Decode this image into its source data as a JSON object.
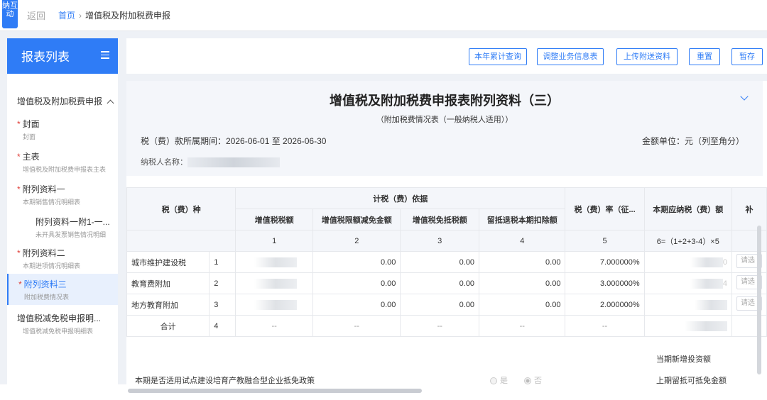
{
  "side_tag": "纳互动",
  "header": {
    "back": "返回",
    "home": "首页",
    "sep": "›",
    "current": "增值税及附加税费申报"
  },
  "sidebar": {
    "title": "报表列表",
    "group": "增值税及附加税费申报",
    "items": [
      {
        "star": "*",
        "title": "封面",
        "sub": "封面"
      },
      {
        "star": "*",
        "title": "主表",
        "sub": "增值税及附加税费申报表主表"
      },
      {
        "star": "*",
        "title": "附列资料一",
        "sub": "本期销售情况明细表"
      },
      {
        "star": "",
        "title": "附列资料一附1-一...",
        "sub": "未开具发票销售情况明细"
      },
      {
        "star": "*",
        "title": "附列资料二",
        "sub": "本期进项情况明细表"
      },
      {
        "star": "*",
        "title": "附列资料三",
        "sub": "附加税费情况表"
      },
      {
        "star": "",
        "title": "增值税减免税申报明...",
        "sub": "增值税减免税申报明细表"
      }
    ]
  },
  "toolbar": {
    "annual_query": "本年累计查询",
    "adjust_info": "调整业务信息表",
    "upload_attachment": "上传附送资料",
    "reset": "重置",
    "save_draft": "暂存"
  },
  "form": {
    "title": "增值税及附加税费申报表附列资料（三）",
    "subtitle": "（附加税费情况表（一般纳税人适用））",
    "period": "税（费）款所属期间：2026-06-01 至 2026-06-30",
    "unit": "金额单位：元（列至角分）",
    "taxpayer_label": "纳税人名称："
  },
  "table": {
    "h_type": "税（费）种",
    "h_basis": "计税（费）依据",
    "h_vat": "增值税税额",
    "h_limit": "增值税限额减免金额",
    "h_exempt": "增值税免抵税额",
    "h_refund": "留抵退税本期扣除额",
    "h_rate": "税（费）率（征...",
    "h_payable": "本期应纳税（费）额",
    "h_extra": "补",
    "n1": "1",
    "n2": "2",
    "n3": "3",
    "n4": "4",
    "n5": "5",
    "n6": "6=（1+2+3-4）×5",
    "rows": [
      {
        "name": "城市维护建设税",
        "no": "1",
        "limit": "0.00",
        "exempt": "0.00",
        "refund": "0.00",
        "rate": "7.000000%",
        "payable_tail": "0",
        "select": "请选"
      },
      {
        "name": "教育费附加",
        "no": "2",
        "limit": "0.00",
        "exempt": "0.00",
        "refund": "0.00",
        "rate": "3.000000%",
        "payable_tail": "4",
        "select": "请选"
      },
      {
        "name": "地方教育附加",
        "no": "3",
        "limit": "0.00",
        "exempt": "0.00",
        "refund": "0.00",
        "rate": "2.000000%",
        "payable_tail": "",
        "select": "请选"
      }
    ],
    "total": {
      "name": "合计",
      "no": "4",
      "dash": "--"
    }
  },
  "policy": {
    "question": "本期是否适用试点建设培育产教融合型企业抵免政策",
    "yes": "是",
    "no": "否",
    "new_invest": "当期新增投资额",
    "prev_credit": "上期留抵可抵免金额"
  }
}
